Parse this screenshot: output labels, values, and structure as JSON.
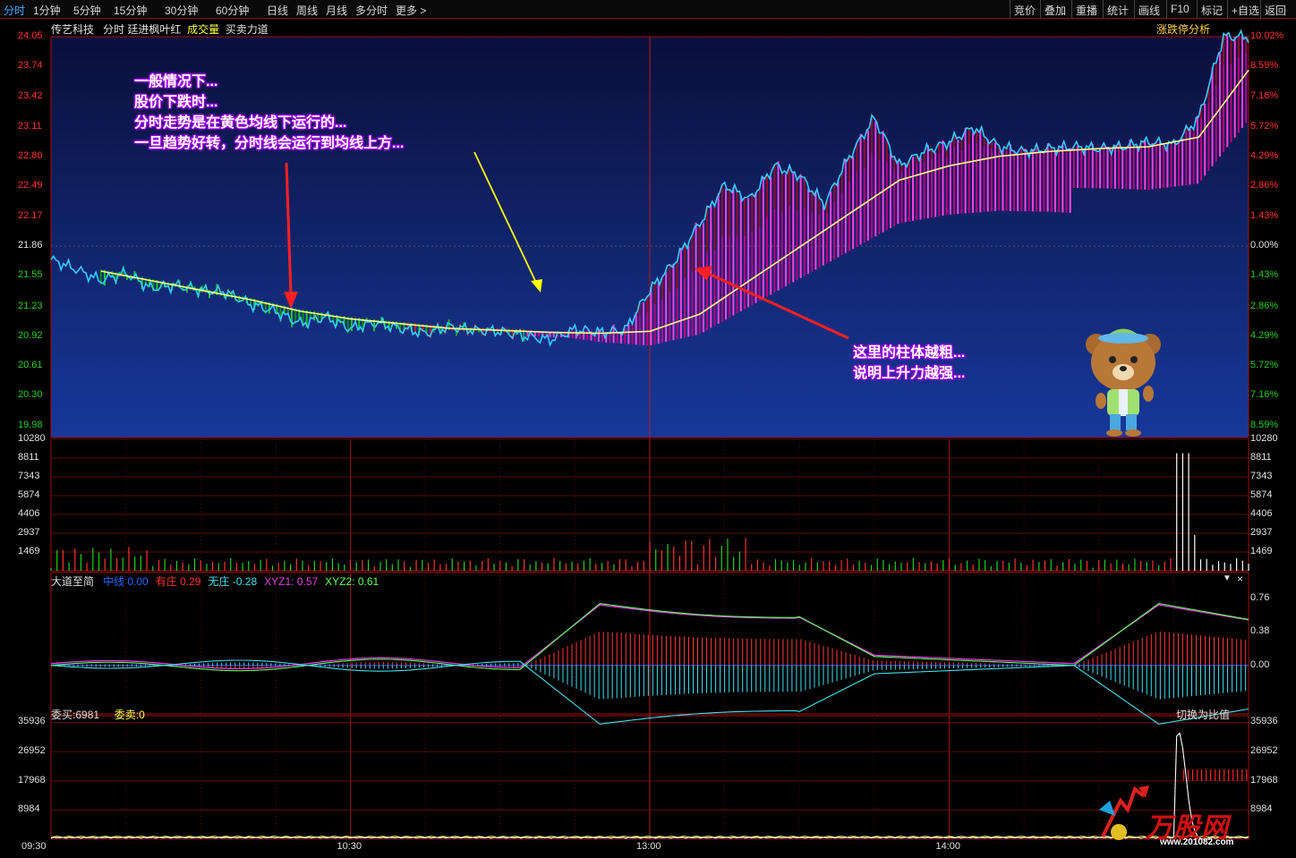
{
  "toolbar": {
    "left": [
      "分时",
      "1分钟",
      "5分钟",
      "15分钟",
      "30分钟",
      "60分钟",
      "日线",
      "周线",
      "月线",
      "多分时",
      "更多 >"
    ],
    "right": [
      "竞价",
      "叠加",
      "重播",
      "统计",
      "画线",
      "F10",
      "标记",
      "+自选",
      "返回"
    ]
  },
  "main_header": {
    "stock": "传艺科技",
    "mode": "分时",
    "indicator": "廷进枫叶红",
    "volume_tab": "成交量",
    "force_tab": "买卖力道",
    "right_link": "涨跌停分析"
  },
  "annotations": {
    "top": [
      "一般情况下...",
      "股价下跌时...",
      "分时走势是在黄色均线下运行的...",
      "一旦趋势好转，分时线会运行到均线上方..."
    ],
    "bottom": [
      "这里的柱体越粗...",
      "说明上升力越强..."
    ]
  },
  "indicator_panel": {
    "name": "大道至简",
    "items": [
      {
        "label": "中线",
        "value": "0.00",
        "color": "#2266ff"
      },
      {
        "label": "有庄",
        "value": "0.29",
        "color": "#ff3030"
      },
      {
        "label": "无庄",
        "value": "-0.28",
        "color": "#40e0f0"
      },
      {
        "label": "XYZ1",
        "value": "0.57",
        "color": "#e040e0"
      },
      {
        "label": "XYZ2",
        "value": "0.61",
        "color": "#60ff60"
      }
    ],
    "close_icon": "×"
  },
  "order_panel": {
    "buy_label": "委买:",
    "buy_value": "6981",
    "sell_label": "委卖:",
    "sell_value": "0",
    "switch": "切换为比值"
  },
  "watermark": {
    "brand": "万股网",
    "url": "www.201082.com"
  },
  "chart_data": [
    {
      "type": "line",
      "panel": "price",
      "y_ticks_left": [
        "24.05",
        "23.74",
        "23.42",
        "23.11",
        "22.80",
        "22.49",
        "22.17",
        "21.86",
        "21.55",
        "21.23",
        "20.92",
        "20.61",
        "20.30",
        "19.98"
      ],
      "y_ticks_right": [
        "10.02%",
        "8.59%",
        "7.16%",
        "5.72%",
        "4.29%",
        "2.86%",
        "1.43%",
        "0.00%",
        "1.43%",
        "2.86%",
        "4.29%",
        "5.72%",
        "7.16%",
        "8.59%"
      ],
      "ylim": [
        19.86,
        24.05
      ],
      "prev_close": 21.86,
      "series": [
        {
          "name": "价格",
          "color": "#33ccff",
          "x": [
            0,
            5,
            10,
            15,
            20,
            25,
            30,
            35,
            40,
            45,
            50,
            55,
            60,
            65,
            70,
            75,
            80,
            85,
            90,
            95,
            100,
            105,
            110,
            115,
            120,
            125,
            130,
            135,
            140,
            145,
            150,
            155,
            160,
            165,
            170,
            175,
            180,
            185,
            190,
            195,
            200,
            205,
            210,
            215,
            220,
            225,
            230,
            235,
            240
          ],
          "values": [
            21.72,
            21.62,
            21.5,
            21.58,
            21.42,
            21.45,
            21.4,
            21.38,
            21.25,
            21.18,
            21.05,
            21.12,
            21.0,
            21.06,
            21.0,
            20.95,
            21.02,
            20.98,
            20.97,
            20.92,
            20.88,
            20.99,
            20.96,
            20.98,
            21.4,
            21.7,
            22.1,
            22.5,
            22.35,
            22.7,
            22.6,
            22.3,
            22.8,
            23.2,
            22.7,
            22.85,
            22.95,
            23.1,
            22.9,
            22.85,
            22.88,
            22.9,
            22.88,
            22.9,
            22.95,
            22.92,
            23.2,
            24.05,
            24.05
          ]
        },
        {
          "name": "均价",
          "color": "#ffff80",
          "x": [
            10,
            20,
            30,
            40,
            50,
            60,
            70,
            80,
            90,
            100,
            110,
            120,
            130,
            140,
            150,
            160,
            170,
            180,
            190,
            200,
            210,
            220,
            230,
            240
          ],
          "values": [
            21.6,
            21.5,
            21.4,
            21.3,
            21.18,
            21.1,
            21.05,
            21.0,
            20.98,
            20.96,
            20.95,
            20.97,
            21.15,
            21.5,
            21.85,
            22.2,
            22.55,
            22.7,
            22.8,
            22.85,
            22.88,
            22.9,
            23.0,
            23.7
          ]
        }
      ]
    },
    {
      "type": "bar",
      "panel": "volume",
      "y_ticks": [
        "10280",
        "8811",
        "7343",
        "5874",
        "4406",
        "2937",
        "1469"
      ],
      "ylim": [
        0,
        10280
      ]
    },
    {
      "type": "line",
      "panel": "indicator",
      "y_ticks": [
        "0.76",
        "0.38",
        "0.00"
      ],
      "ylim": [
        -0.55,
        1.05
      ]
    },
    {
      "type": "line",
      "panel": "orders",
      "y_ticks": [
        "35936",
        "26952",
        "17968",
        "8984"
      ],
      "ylim": [
        0,
        38000
      ],
      "x_ticks": [
        "09:30",
        "10:30",
        "13:00",
        "14:00"
      ]
    }
  ]
}
